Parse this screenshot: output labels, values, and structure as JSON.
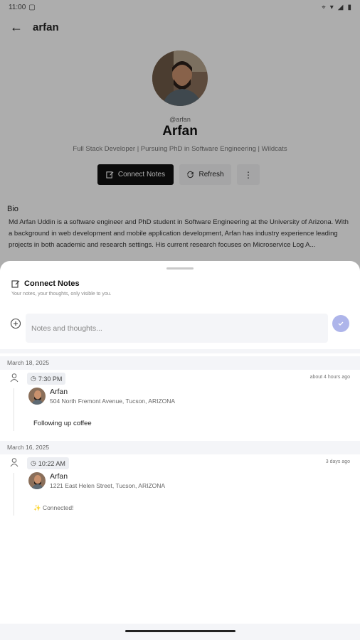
{
  "status_bar": {
    "time": "11:00"
  },
  "app_bar": {
    "title": "arfan"
  },
  "profile": {
    "handle": "@arfan",
    "name": "Arfan",
    "tagline": "Full Stack Developer | Pursuing PhD in Software Engineering | Wildcats",
    "actions": {
      "connect": "Connect Notes",
      "refresh": "Refresh",
      "more": "⋮"
    },
    "bio_title": "Bio",
    "bio_text": "Md Arfan Uddin is a software engineer and PhD student in Software Engineering at the University of Arizona. With a background in web development and mobile application development, Arfan has industry experience leading projects in both academic and research settings. His current research focuses on Microservice Log A..."
  },
  "sheet": {
    "title": "Connect Notes",
    "subtitle": "Your notes, your thoughts, only visible to you.",
    "input_placeholder": "Notes and thoughts...",
    "groups": [
      {
        "date": "March 18, 2025",
        "time": "7:30 PM",
        "relative": "about 4 hours ago",
        "author": "Arfan",
        "location": "504 North Fremont Avenue, Tucson, ARIZONA",
        "note": "Following up coffee"
      },
      {
        "date": "March 16, 2025",
        "time": "10:22 AM",
        "relative": "3 days ago",
        "author": "Arfan",
        "location": "1221 East Helen Street, Tucson, ARIZONA",
        "note": "✨ Connected!"
      }
    ]
  },
  "colors": {
    "primary": "#111111",
    "send_button": "#aeb5ea",
    "surface": "#f4f5f8"
  },
  "icons": [
    "back-arrow-icon",
    "edit-note-icon",
    "refresh-icon",
    "more-vert-icon",
    "add-circle-icon",
    "check-icon",
    "person-icon",
    "clock-icon"
  ]
}
